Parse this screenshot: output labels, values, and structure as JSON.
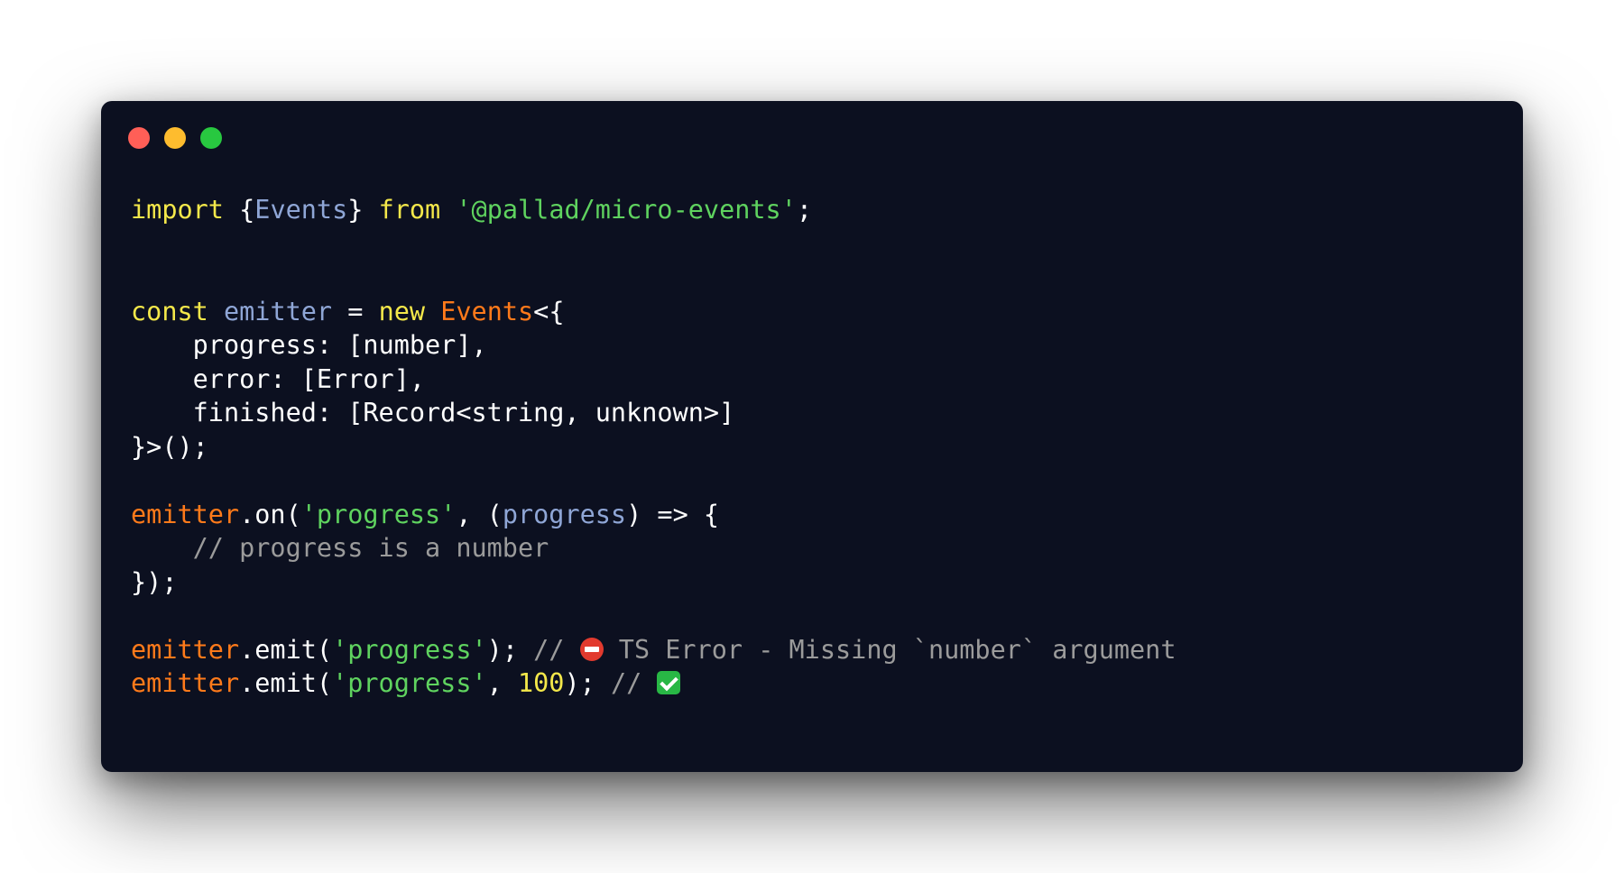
{
  "window": {
    "controls": [
      {
        "name": "close",
        "color": "#ff5f57"
      },
      {
        "name": "minimize",
        "color": "#febc2e"
      },
      {
        "name": "zoom",
        "color": "#28c840"
      }
    ]
  },
  "colors": {
    "background": "#0c1020",
    "keyword": "#f4e84a",
    "identifier": "#8fa6d6",
    "class": "#ff7a1a",
    "string": "#5fd35f",
    "number": "#f4e84a",
    "punctuation": "#ffffff",
    "comment": "#9b9b9b"
  },
  "code": {
    "lines": [
      {
        "tokens": [
          {
            "t": "import",
            "c": "keyword"
          },
          {
            "t": " {",
            "c": "punctuation"
          },
          {
            "t": "Events",
            "c": "identifier"
          },
          {
            "t": "} ",
            "c": "punctuation"
          },
          {
            "t": "from",
            "c": "keyword"
          },
          {
            "t": " ",
            "c": "punctuation"
          },
          {
            "t": "'@pallad/micro-events'",
            "c": "string"
          },
          {
            "t": ";",
            "c": "punctuation"
          }
        ]
      },
      {
        "tokens": []
      },
      {
        "tokens": []
      },
      {
        "tokens": [
          {
            "t": "const",
            "c": "keyword"
          },
          {
            "t": " ",
            "c": "punctuation"
          },
          {
            "t": "emitter",
            "c": "identifier"
          },
          {
            "t": " = ",
            "c": "punctuation"
          },
          {
            "t": "new",
            "c": "keyword"
          },
          {
            "t": " ",
            "c": "punctuation"
          },
          {
            "t": "Events",
            "c": "class"
          },
          {
            "t": "<{",
            "c": "punctuation"
          }
        ]
      },
      {
        "tokens": [
          {
            "t": "    progress: [number],",
            "c": "punctuation"
          }
        ]
      },
      {
        "tokens": [
          {
            "t": "    error: [Error],",
            "c": "punctuation"
          }
        ]
      },
      {
        "tokens": [
          {
            "t": "    finished: [Record<string, unknown>]",
            "c": "punctuation"
          }
        ]
      },
      {
        "tokens": [
          {
            "t": "}>();",
            "c": "punctuation"
          }
        ]
      },
      {
        "tokens": []
      },
      {
        "tokens": [
          {
            "t": "emitter",
            "c": "class"
          },
          {
            "t": ".on(",
            "c": "punctuation"
          },
          {
            "t": "'progress'",
            "c": "string"
          },
          {
            "t": ", (",
            "c": "punctuation"
          },
          {
            "t": "progress",
            "c": "identifier"
          },
          {
            "t": ") => {",
            "c": "punctuation"
          }
        ]
      },
      {
        "tokens": [
          {
            "t": "    // progress is a number",
            "c": "comment"
          }
        ]
      },
      {
        "tokens": [
          {
            "t": "});",
            "c": "punctuation"
          }
        ]
      },
      {
        "tokens": []
      },
      {
        "tokens": [
          {
            "t": "emitter",
            "c": "class"
          },
          {
            "t": ".emit(",
            "c": "punctuation"
          },
          {
            "t": "'progress'",
            "c": "string"
          },
          {
            "t": "); ",
            "c": "punctuation"
          },
          {
            "t": "// ",
            "c": "comment"
          },
          {
            "icon": "no-entry-emoji"
          },
          {
            "t": " TS Error - Missing `number` argument",
            "c": "comment"
          }
        ]
      },
      {
        "tokens": [
          {
            "t": "emitter",
            "c": "class"
          },
          {
            "t": ".emit(",
            "c": "punctuation"
          },
          {
            "t": "'progress'",
            "c": "string"
          },
          {
            "t": ", ",
            "c": "punctuation"
          },
          {
            "t": "100",
            "c": "number"
          },
          {
            "t": "); ",
            "c": "punctuation"
          },
          {
            "t": "// ",
            "c": "comment"
          },
          {
            "icon": "check-mark-emoji"
          }
        ]
      }
    ]
  }
}
